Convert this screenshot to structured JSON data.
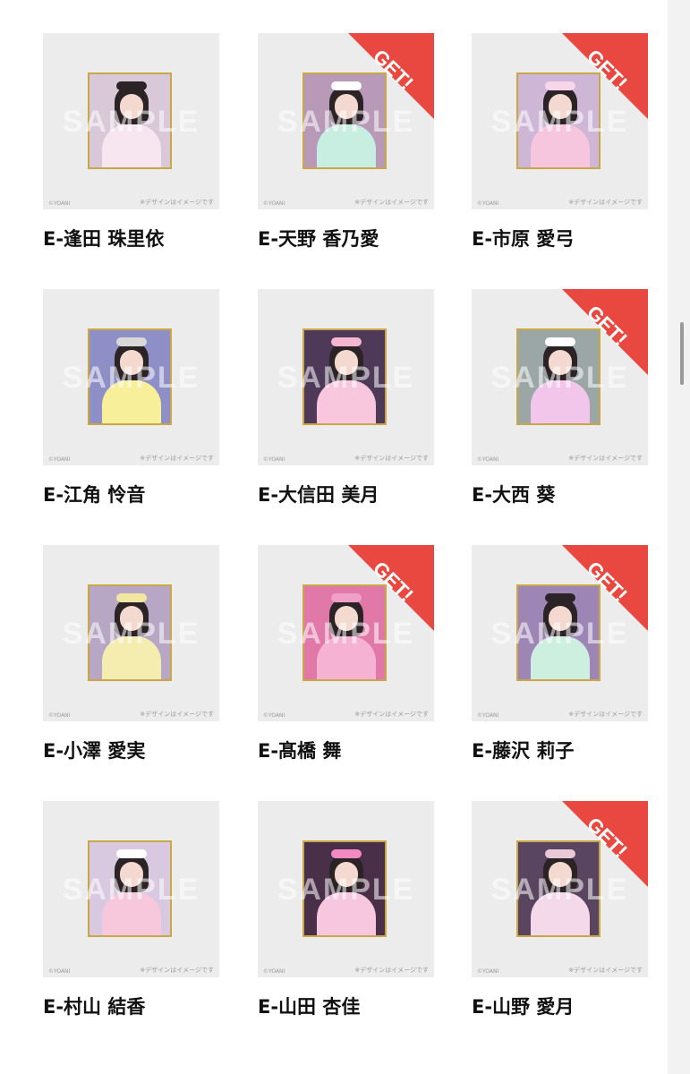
{
  "cards": [
    {
      "name": "E-逢田 珠里依",
      "get": false,
      "bg": "#d9c8d8",
      "body": "#f7e6f0",
      "acc": "#2b2326"
    },
    {
      "name": "E-天野 香乃愛",
      "get": true,
      "bg": "#b89ab8",
      "body": "#c8eee2",
      "acc": "#ffffff"
    },
    {
      "name": "E-市原 愛弓",
      "get": true,
      "bg": "#cdb6d6",
      "body": "#f6c6df",
      "acc": "#f7d6ea"
    },
    {
      "name": "E-江角 怜音",
      "get": false,
      "bg": "#8f8fc8",
      "body": "#f7ef9a",
      "acc": "#d8d8d8"
    },
    {
      "name": "E-大信田 美月",
      "get": false,
      "bg": "#4e3a58",
      "body": "#f8c7dd",
      "acc": "#f4b6d0"
    },
    {
      "name": "E-大西 葵",
      "get": true,
      "bg": "#9aa7a4",
      "body": "#f2c6ea",
      "acc": "#ffffff"
    },
    {
      "name": "E-小澤 愛実",
      "get": false,
      "bg": "#b7a7c4",
      "body": "#f5ecb0",
      "acc": "#f1e7a3"
    },
    {
      "name": "E-髙橋 舞",
      "get": true,
      "bg": "#e078a8",
      "body": "#f5b2d2",
      "acc": "#f0a0c8"
    },
    {
      "name": "E-藤沢 莉子",
      "get": true,
      "bg": "#9d86b6",
      "body": "#cdefe0",
      "acc": "#2b2326"
    },
    {
      "name": "E-村山 結香",
      "get": false,
      "bg": "#d8c8e0",
      "body": "#f7c7dc",
      "acc": "#ffffff"
    },
    {
      "name": "E-山田 杏佳",
      "get": false,
      "bg": "#4a2f48",
      "body": "#f7c7df",
      "acc": "#f38ac4"
    },
    {
      "name": "E-山野 愛月",
      "get": true,
      "bg": "#5a4560",
      "body": "#f4d9ea",
      "acc": "#e9c8d8"
    }
  ],
  "labels": {
    "sample": "SAMPLE",
    "get": "GET!",
    "copyright": "©YOANI",
    "note": "※デザインはイメージです"
  },
  "colors": {
    "get_banner": "#e8483f",
    "frame_gold": "#c9a646",
    "tile_bg": "#ececec"
  }
}
